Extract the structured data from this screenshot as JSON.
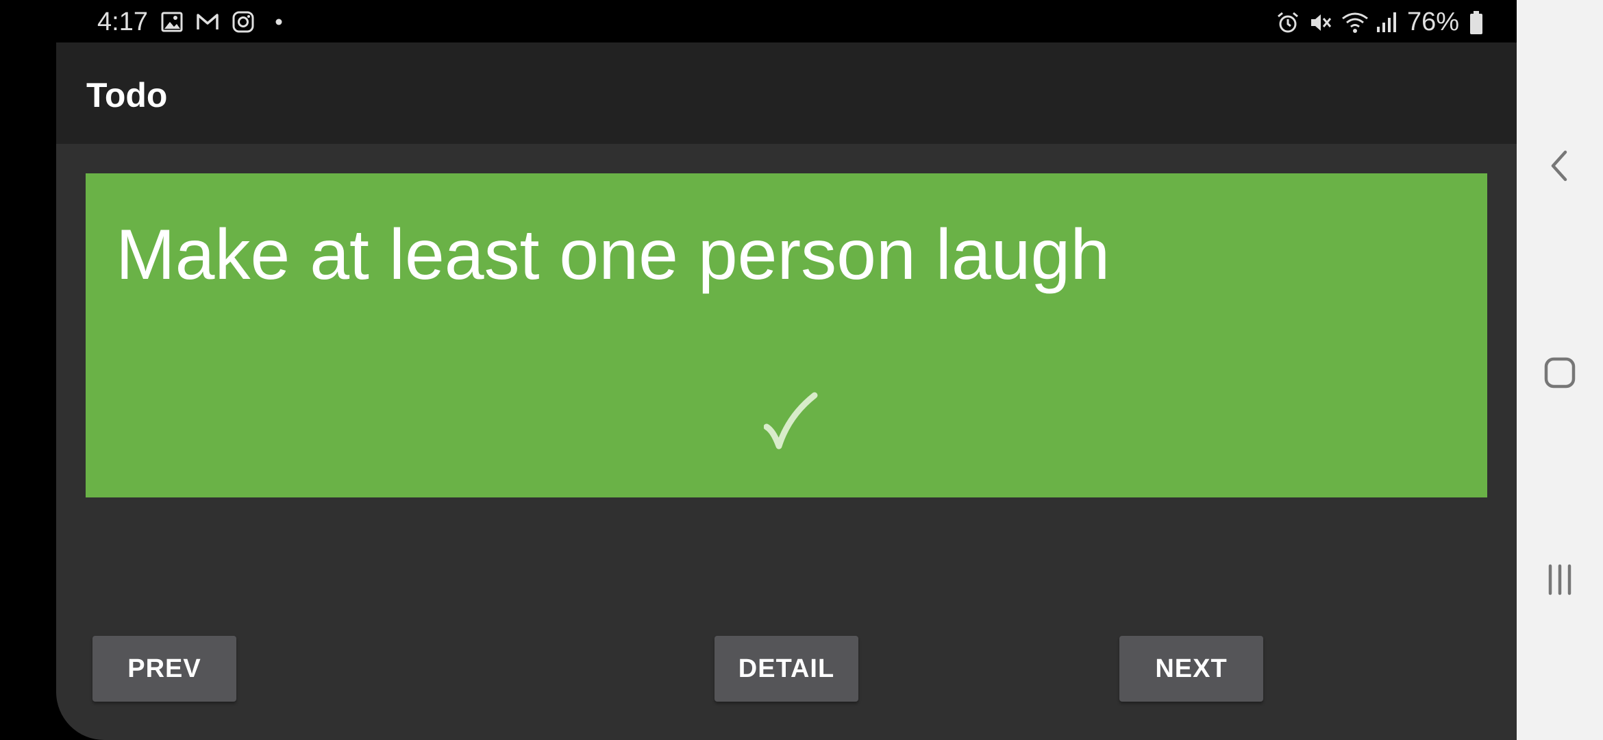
{
  "status_bar": {
    "time": "4:17",
    "left_icons": [
      "gallery-icon",
      "gmail-icon",
      "instagram-icon",
      "dot-icon"
    ],
    "right_icons": [
      "alarm-icon",
      "mute-icon",
      "wifi-icon",
      "signal-icon"
    ],
    "battery": "76%"
  },
  "app_bar": {
    "title": "Todo"
  },
  "card": {
    "text": "Make at least one person laugh",
    "color": "#6ab247",
    "check_icon": "check-icon"
  },
  "buttons": {
    "prev": "PREV",
    "detail": "DETAIL",
    "next": "NEXT"
  },
  "nav_bar": {
    "icons": [
      "back-icon",
      "home-icon",
      "recents-icon"
    ]
  }
}
